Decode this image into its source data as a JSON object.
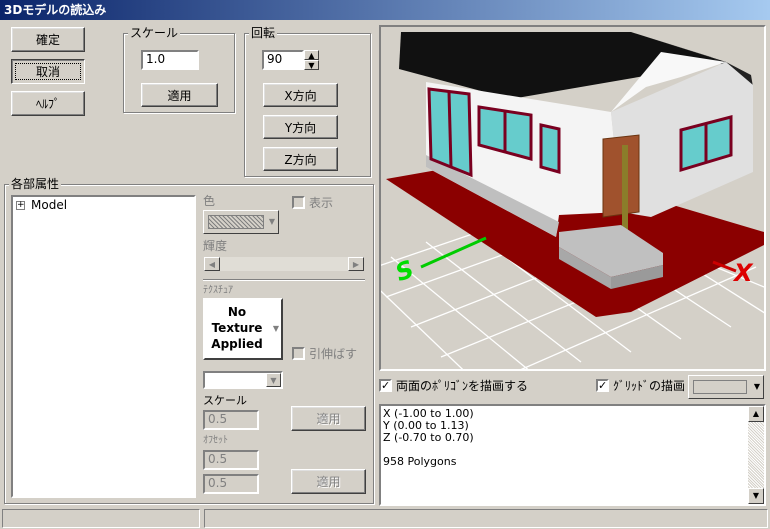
{
  "window": {
    "title": "3Dモデルの読込み"
  },
  "buttons": {
    "ok": "確定",
    "cancel": "取消",
    "help": "ﾍﾙﾌﾟ"
  },
  "scale": {
    "label": "スケール",
    "value": "1.0",
    "apply": "適用"
  },
  "rotation": {
    "label": "回転",
    "value": "90",
    "x": "X方向",
    "y": "Y方向",
    "z": "Z方向"
  },
  "attributes": {
    "label": "各部属性",
    "tree": {
      "expander": "+",
      "root": "Model"
    },
    "color_label": "色",
    "show_label": "表示",
    "brightness_label": "輝度",
    "texture_label": "ﾃｸｽﾁｭｱ",
    "texture_preview": "No\nTexture\nApplied",
    "stretch_label": "引伸ばす",
    "tex_scale_label": "スケール",
    "tex_scale_value": "0.5",
    "apply1": "適用",
    "offset_label": "ｵﾌｾｯﾄ",
    "offset_x": "0.5",
    "offset_y": "0.5",
    "apply2": "適用"
  },
  "preview": {
    "backface_label": "両面のﾎﾟﾘｺﾞﾝを描画する",
    "backface_checked": "✓",
    "grid_label": "ｸﾞﾘｯﾄﾞの描画",
    "grid_checked": "✓",
    "axis_x": "X",
    "axis_s": "S",
    "info": {
      "x": "X (-1.00 to 1.00)",
      "y": "Y (0.00 to 1.13)",
      "z": "Z (-0.70 to 0.70)",
      "polygons": "958 Polygons"
    }
  },
  "colors": {
    "title_start": "#0a246a",
    "wall": "#ffffff",
    "roof": "#111111",
    "window_frame": "#800020",
    "glass": "#66cccc",
    "base": "#8b0000",
    "grid": "#ffffff",
    "axis_green": "#00cc00",
    "axis_red": "#cc0000"
  }
}
